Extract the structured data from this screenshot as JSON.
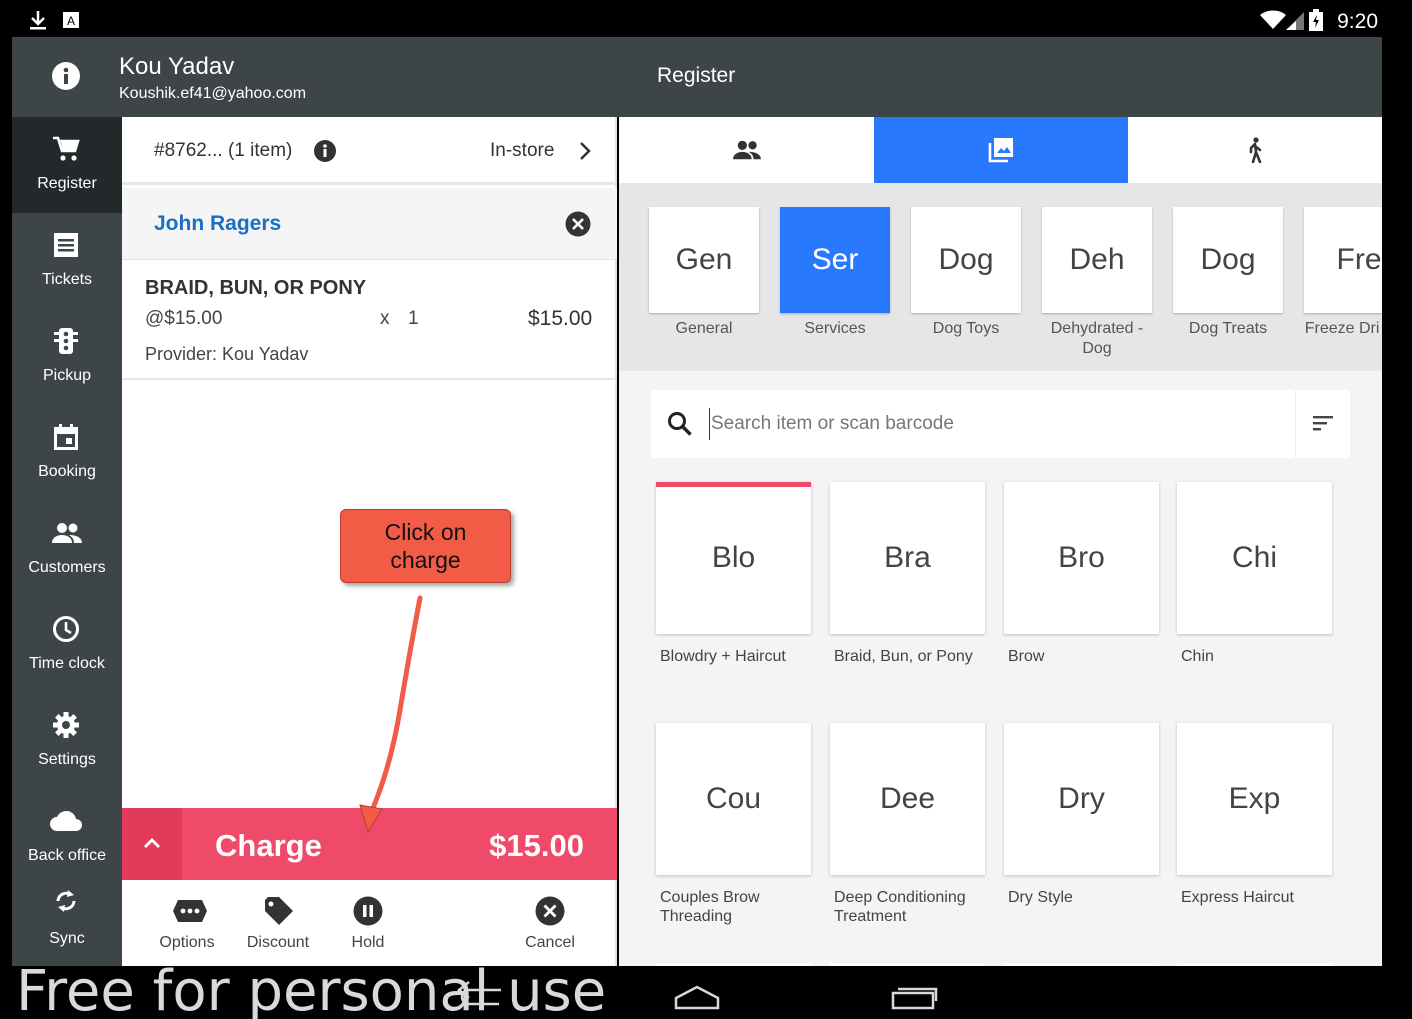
{
  "status_bar": {
    "time": "9:20"
  },
  "header": {
    "user_name": "Kou Yadav",
    "user_email": "Koushik.ef41@yahoo.com",
    "title": "Register"
  },
  "sidebar": {
    "items": [
      {
        "label": "Register",
        "icon": "cart-icon",
        "active": true
      },
      {
        "label": "Tickets",
        "icon": "tickets-icon"
      },
      {
        "label": "Pickup",
        "icon": "traffic-light-icon"
      },
      {
        "label": "Booking",
        "icon": "calendar-icon"
      },
      {
        "label": "Customers",
        "icon": "people-icon"
      },
      {
        "label": "Time clock",
        "icon": "clock-icon"
      },
      {
        "label": "Settings",
        "icon": "gear-icon"
      },
      {
        "label": "Back office",
        "icon": "cloud-icon"
      },
      {
        "label": "Sync",
        "icon": "sync-icon"
      }
    ]
  },
  "ticket": {
    "number": "#8762... (1 item)",
    "mode": "In-store",
    "customer": "John Ragers",
    "line_item": {
      "name": "BRAID, BUN, OR PONY",
      "unit_price": "@$15.00",
      "x": "x",
      "qty": "1",
      "price": "$15.00",
      "provider": "Provider: Kou Yadav"
    },
    "charge_label": "Charge",
    "charge_amount": "$15.00",
    "actions": [
      {
        "label": "Options",
        "icon": "options-icon"
      },
      {
        "label": "Discount",
        "icon": "tag-icon"
      },
      {
        "label": "Hold",
        "icon": "pause-icon"
      },
      {
        "label": "Cancel",
        "icon": "cancel-icon"
      }
    ]
  },
  "annotation": {
    "line1": "Click on",
    "line2": "charge",
    "color": "#f25b45"
  },
  "catalog": {
    "view_tabs": [
      {
        "name": "customers",
        "icon": "people-icon"
      },
      {
        "name": "gallery",
        "icon": "gallery-icon",
        "active": true
      },
      {
        "name": "walk-in",
        "icon": "walk-icon"
      }
    ],
    "categories": [
      {
        "abbr": "Gen",
        "label": "General"
      },
      {
        "abbr": "Ser",
        "label": "Services",
        "active": true
      },
      {
        "abbr": "Dog",
        "label": "Dog Toys"
      },
      {
        "abbr": "Deh",
        "label": "Dehydrated - Dog"
      },
      {
        "abbr": "Dog",
        "label": "Dog Treats"
      },
      {
        "abbr": "Fre",
        "label": "Freeze Dri Dog"
      }
    ],
    "search_placeholder": "Search item or scan barcode",
    "products": [
      {
        "abbr": "Blo",
        "label": "Blowdry + Haircut",
        "highlight": true
      },
      {
        "abbr": "Bra",
        "label": "Braid, Bun, or Pony"
      },
      {
        "abbr": "Bro",
        "label": "Brow"
      },
      {
        "abbr": "Chi",
        "label": "Chin"
      },
      {
        "abbr": "Cou",
        "label": "Couples Brow Threading"
      },
      {
        "abbr": "Dee",
        "label": "Deep Conditioning Treatment"
      },
      {
        "abbr": "Dry",
        "label": "Dry Style"
      },
      {
        "abbr": "Exp",
        "label": "Express Haircut"
      }
    ]
  },
  "watermark": "Free for personal use",
  "colors": {
    "accent": "#2979ff",
    "charge": "#f04a6a",
    "sidebar": "#3e4548",
    "customer_link": "#1a6fc4"
  }
}
